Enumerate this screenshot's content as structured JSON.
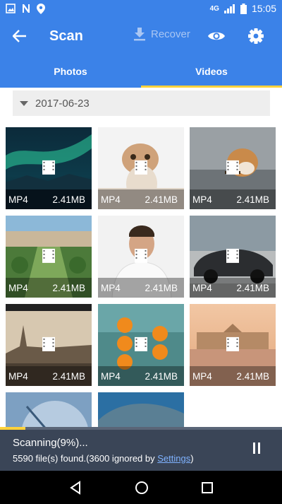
{
  "status": {
    "network": "4G",
    "time": "15:05",
    "icons": [
      "image-icon",
      "n-icon",
      "location-icon",
      "signal-icon",
      "battery-icon"
    ]
  },
  "appbar": {
    "title": "Scan",
    "recover_label": "Recover"
  },
  "tabs": [
    {
      "label": "Photos"
    },
    {
      "label": "Videos"
    }
  ],
  "date_group": {
    "label": "2017-06-23"
  },
  "videos": [
    {
      "format": "MP4",
      "size": "2.41MB",
      "subject": "aurora"
    },
    {
      "format": "MP4",
      "size": "2.41MB",
      "subject": "kitten"
    },
    {
      "format": "MP4",
      "size": "2.41MB",
      "subject": "puppy"
    },
    {
      "format": "MP4",
      "size": "2.41MB",
      "subject": "palace-park"
    },
    {
      "format": "MP4",
      "size": "2.41MB",
      "subject": "man-portrait"
    },
    {
      "format": "MP4",
      "size": "2.41MB",
      "subject": "sports-car"
    },
    {
      "format": "MP4",
      "size": "2.41MB",
      "subject": "vienna-city"
    },
    {
      "format": "MP4",
      "size": "2.41MB",
      "subject": "pumpkins"
    },
    {
      "format": "MP4",
      "size": "2.41MB",
      "subject": "schonbrunn"
    },
    {
      "format": "",
      "size": "",
      "subject": "compass"
    },
    {
      "format": "",
      "size": "",
      "subject": "whale"
    }
  ],
  "scan": {
    "status_text": "Scanning(9%)...",
    "progress_fraction": 0.09,
    "found_prefix": "5590 file(s) found.(3600 ignored by ",
    "settings_link": "Settings",
    "found_suffix": ")"
  },
  "colors": {
    "primary": "#3b82e8",
    "accent": "#ffd23b",
    "bottom_bar": "#3a4557"
  }
}
